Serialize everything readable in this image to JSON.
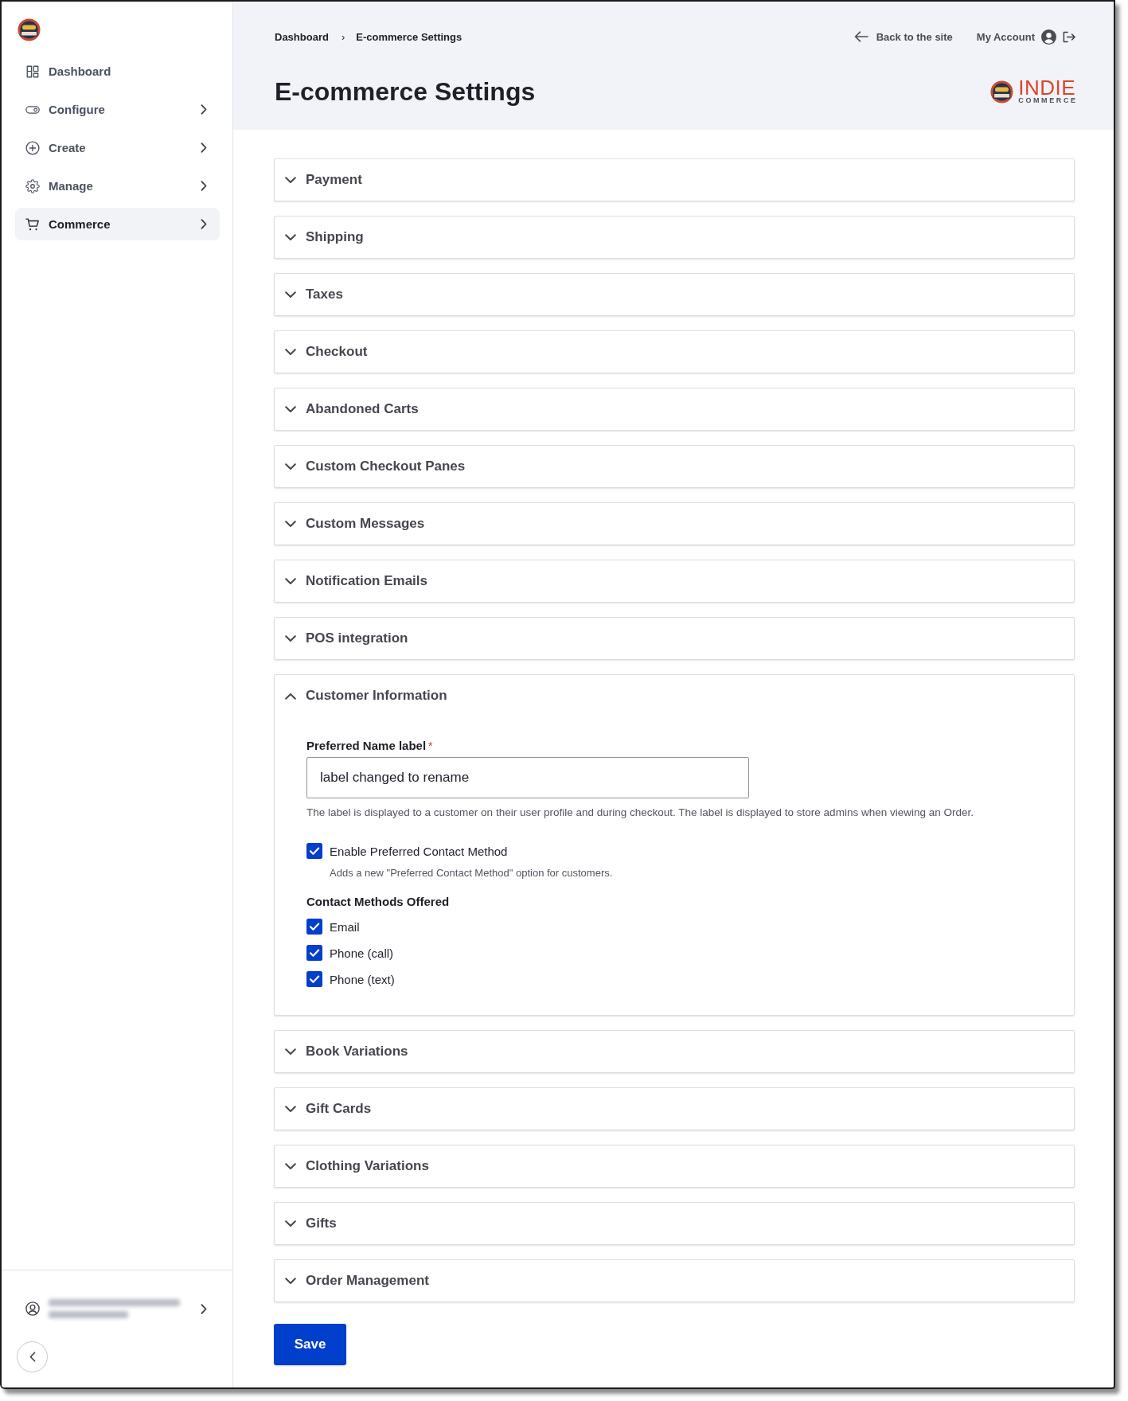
{
  "sidebar": {
    "items": [
      {
        "label": "Dashboard",
        "expandable": false,
        "selected": false
      },
      {
        "label": "Configure",
        "expandable": true,
        "selected": false
      },
      {
        "label": "Create",
        "expandable": true,
        "selected": false
      },
      {
        "label": "Manage",
        "expandable": true,
        "selected": false
      },
      {
        "label": "Commerce",
        "expandable": true,
        "selected": true
      }
    ]
  },
  "header": {
    "breadcrumb": [
      {
        "label": "Dashboard"
      },
      {
        "label": "E-commerce Settings"
      }
    ],
    "breadcrumb_separator": "›",
    "back_link": "Back to the site",
    "account_link": "My Account",
    "title": "E-commerce Settings",
    "brand": {
      "name": "INDIE",
      "tagline": "COMMERCE"
    }
  },
  "sections": [
    {
      "title": "Payment",
      "expanded": false
    },
    {
      "title": "Shipping",
      "expanded": false
    },
    {
      "title": "Taxes",
      "expanded": false
    },
    {
      "title": "Checkout",
      "expanded": false
    },
    {
      "title": "Abandoned Carts",
      "expanded": false
    },
    {
      "title": "Custom Checkout Panes",
      "expanded": false
    },
    {
      "title": "Custom Messages",
      "expanded": false
    },
    {
      "title": "Notification Emails",
      "expanded": false
    },
    {
      "title": "POS integration",
      "expanded": false
    },
    {
      "title": "Customer Information",
      "expanded": true,
      "content": {
        "name_field": {
          "label": "Preferred Name label",
          "required_mark": "*",
          "value": "label changed to rename",
          "help": "The label is displayed to a customer on their user profile and during checkout. The label is displayed to store admins when viewing an Order."
        },
        "enable_contact": {
          "label": "Enable Preferred Contact Method",
          "checked": true,
          "description": "Adds a new \"Preferred Contact Method\" option for customers."
        },
        "contact_methods": {
          "label": "Contact Methods Offered",
          "options": [
            {
              "label": "Email",
              "checked": true
            },
            {
              "label": "Phone (call)",
              "checked": true
            },
            {
              "label": "Phone (text)",
              "checked": true
            }
          ]
        }
      }
    },
    {
      "title": "Book Variations",
      "expanded": false
    },
    {
      "title": "Gift Cards",
      "expanded": false
    },
    {
      "title": "Clothing Variations",
      "expanded": false
    },
    {
      "title": "Gifts",
      "expanded": false
    },
    {
      "title": "Order Management",
      "expanded": false
    }
  ],
  "save_button": "Save"
}
